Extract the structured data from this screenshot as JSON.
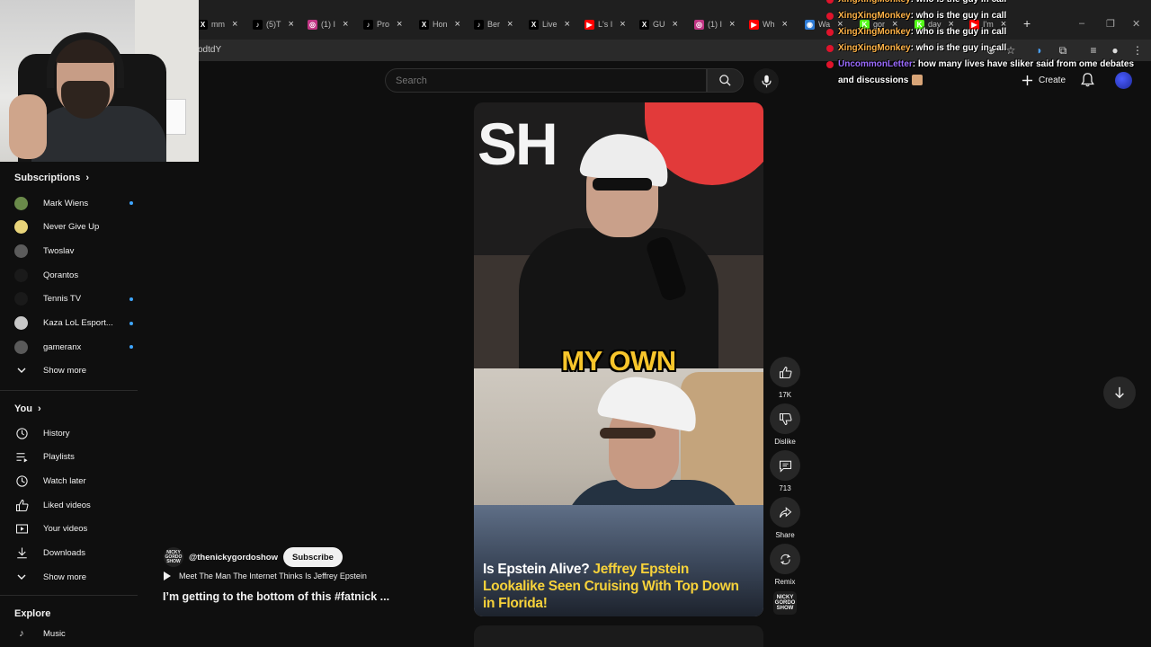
{
  "browser": {
    "tabs": [
      {
        "icon": "x-icon",
        "label": "mm",
        "color": "#000000"
      },
      {
        "icon": "tiktok-icon",
        "label": "(5)T",
        "color": "#000000"
      },
      {
        "icon": "instagram-icon",
        "label": "(1) I",
        "color": "#c13584"
      },
      {
        "icon": "tiktok-icon",
        "label": "Pro",
        "color": "#000000"
      },
      {
        "icon": "x-icon",
        "label": "Hon",
        "color": "#000000"
      },
      {
        "icon": "tiktok-icon",
        "label": "Ber",
        "color": "#000000"
      },
      {
        "icon": "x-icon",
        "label": "Live",
        "color": "#000000"
      },
      {
        "icon": "youtube-icon",
        "label": "L's I",
        "color": "#ff0000"
      },
      {
        "icon": "x-icon",
        "label": "GU",
        "color": "#000000"
      },
      {
        "icon": "instagram-icon",
        "label": "(1) I",
        "color": "#c13584"
      },
      {
        "icon": "youtube-icon",
        "label": "Wh",
        "color": "#ff0000"
      },
      {
        "icon": "world-icon",
        "label": "Wa",
        "color": "#2d7bd6"
      },
      {
        "icon": "kick-icon",
        "label": "gor",
        "color": "#53fc18"
      },
      {
        "icon": "kick-icon",
        "label": "dav",
        "color": "#53fc18"
      },
      {
        "icon": "youtube-icon",
        "label": "I'm",
        "color": "#ff0000"
      }
    ],
    "url_fragment": "odtdY"
  },
  "chat": [
    {
      "user": "XingXingMonkey",
      "message": ": who is the guy in call"
    },
    {
      "user": "XingXingMonkey",
      "message": ": who is the guy in call"
    },
    {
      "user": "XingXingMonkey",
      "message": ": who is the guy in call"
    },
    {
      "user": "XingXingMonkey",
      "message": ": who is the guy in call"
    },
    {
      "user": "UncommonLetter",
      "message": ": how many lives have sliker said from ome debates and discussions"
    }
  ],
  "header": {
    "search_placeholder": "Search",
    "create_label": "Create"
  },
  "sidebar": {
    "subscriptions_title": "Subscriptions",
    "subscriptions": [
      {
        "name": "Mark Wiens",
        "new": true,
        "color": "#6a8a4a"
      },
      {
        "name": "Never Give Up",
        "new": false,
        "color": "#e8d47a"
      },
      {
        "name": "Twoslav",
        "new": false,
        "color": "#5b5b5b"
      },
      {
        "name": "Qorantos",
        "new": false,
        "color": "#1a1a1a"
      },
      {
        "name": "Tennis TV",
        "new": true,
        "color": "#1a1a1a"
      },
      {
        "name": "Kaza LoL Esport...",
        "new": true,
        "color": "#c8c8c8"
      },
      {
        "name": "gameranx",
        "new": true,
        "color": "#5a5a5a"
      }
    ],
    "show_more_1": "Show more",
    "you_title": "You",
    "you_items": [
      {
        "icon": "history-icon",
        "label": "History"
      },
      {
        "icon": "playlists-icon",
        "label": "Playlists"
      },
      {
        "icon": "watch-later-icon",
        "label": "Watch later"
      },
      {
        "icon": "liked-icon",
        "label": "Liked videos"
      },
      {
        "icon": "your-videos-icon",
        "label": "Your videos"
      },
      {
        "icon": "downloads-icon",
        "label": "Downloads"
      }
    ],
    "show_more_2": "Show more",
    "explore_title": "Explore",
    "explore_first": "Music"
  },
  "short": {
    "overlay_top_text": "SH",
    "caption": "MY OWN",
    "title_white": "Is Epstein Alive?",
    "title_yellow": "Jeffrey Epstein Lookalike Seen Cruising With Top Down in Florida!",
    "channel_logo_text": "NICKY GORDO SHOW",
    "channel_handle": "@thenickygordoshow",
    "subscribe_label": "Subscribe",
    "related_video": "Meet The Man The Internet Thinks Is Jeffrey Epstein",
    "short_title": "I’m getting to the bottom of this #fatnick ...",
    "actions": {
      "likes": "17K",
      "dislike": "Dislike",
      "comments": "713",
      "share": "Share",
      "remix": "Remix"
    }
  }
}
